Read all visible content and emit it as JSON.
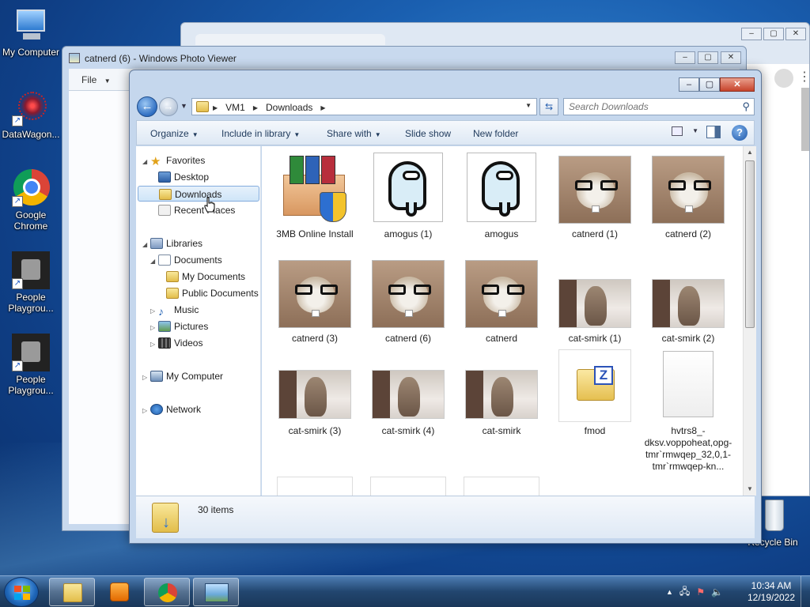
{
  "desktop": {
    "icons": [
      {
        "label": "My Computer"
      },
      {
        "label": "DataWagon..."
      },
      {
        "label": "Google Chrome"
      },
      {
        "label": "People Playgrou..."
      },
      {
        "label": "People Playgrou..."
      },
      {
        "label": "Recycle Bin"
      }
    ]
  },
  "photo_viewer": {
    "title": "catnerd (6) - Windows Photo Viewer",
    "file_menu": "File"
  },
  "explorer": {
    "breadcrumb": [
      "VM1",
      "Downloads"
    ],
    "search_placeholder": "Search Downloads",
    "toolbar": {
      "organize": "Organize",
      "include_in_library": "Include in library",
      "share_with": "Share with",
      "slide_show": "Slide show",
      "new_folder": "New folder"
    },
    "nav": {
      "favorites": "Favorites",
      "desktop": "Desktop",
      "downloads": "Downloads",
      "recent_places": "Recent Places",
      "libraries": "Libraries",
      "documents": "Documents",
      "my_documents": "My Documents",
      "public_documents": "Public Documents",
      "music": "Music",
      "pictures": "Pictures",
      "videos": "Videos",
      "my_computer": "My Computer",
      "network": "Network"
    },
    "files": [
      {
        "name": "3MB Online Install",
        "icon": "installer-icon"
      },
      {
        "name": "amogus (1)",
        "icon": "amogus-thumbnail"
      },
      {
        "name": "amogus",
        "icon": "amogus-thumbnail"
      },
      {
        "name": "catnerd (1)",
        "icon": "cat-thumbnail"
      },
      {
        "name": "catnerd (2)",
        "icon": "cat-thumbnail"
      },
      {
        "name": "catnerd (3)",
        "icon": "cat-thumbnail"
      },
      {
        "name": "catnerd (6)",
        "icon": "cat-thumbnail"
      },
      {
        "name": "catnerd",
        "icon": "cat-thumbnail"
      },
      {
        "name": "cat-smirk (1)",
        "icon": "cat-smirk-thumbnail"
      },
      {
        "name": "cat-smirk (2)",
        "icon": "cat-smirk-thumbnail"
      },
      {
        "name": "cat-smirk (3)",
        "icon": "cat-smirk-thumbnail"
      },
      {
        "name": "cat-smirk (4)",
        "icon": "cat-smirk-thumbnail"
      },
      {
        "name": "cat-smirk",
        "icon": "cat-smirk-thumbnail"
      },
      {
        "name": "fmod",
        "icon": "zip-folder-icon"
      },
      {
        "name": "hvtrs8_-dksv.voppoheat,opg-tmr`rmwqep_32,0,1-tmr`rmwqep-kn...",
        "icon": "blank-file-icon"
      }
    ],
    "status": {
      "item_count": "30 items"
    }
  },
  "taskbar": {
    "clock_time": "10:34 AM",
    "clock_date": "12/19/2022"
  }
}
